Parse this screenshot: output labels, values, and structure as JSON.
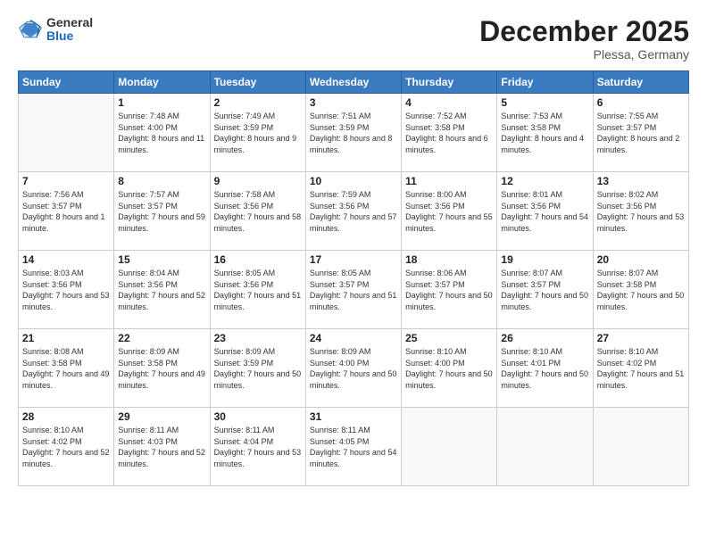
{
  "header": {
    "logo": {
      "general": "General",
      "blue": "Blue"
    },
    "title": "December 2025",
    "location": "Plessa, Germany"
  },
  "days_of_week": [
    "Sunday",
    "Monday",
    "Tuesday",
    "Wednesday",
    "Thursday",
    "Friday",
    "Saturday"
  ],
  "weeks": [
    [
      {
        "day": "",
        "empty": true
      },
      {
        "day": "1",
        "sunrise": "Sunrise: 7:48 AM",
        "sunset": "Sunset: 4:00 PM",
        "daylight": "Daylight: 8 hours and 11 minutes."
      },
      {
        "day": "2",
        "sunrise": "Sunrise: 7:49 AM",
        "sunset": "Sunset: 3:59 PM",
        "daylight": "Daylight: 8 hours and 9 minutes."
      },
      {
        "day": "3",
        "sunrise": "Sunrise: 7:51 AM",
        "sunset": "Sunset: 3:59 PM",
        "daylight": "Daylight: 8 hours and 8 minutes."
      },
      {
        "day": "4",
        "sunrise": "Sunrise: 7:52 AM",
        "sunset": "Sunset: 3:58 PM",
        "daylight": "Daylight: 8 hours and 6 minutes."
      },
      {
        "day": "5",
        "sunrise": "Sunrise: 7:53 AM",
        "sunset": "Sunset: 3:58 PM",
        "daylight": "Daylight: 8 hours and 4 minutes."
      },
      {
        "day": "6",
        "sunrise": "Sunrise: 7:55 AM",
        "sunset": "Sunset: 3:57 PM",
        "daylight": "Daylight: 8 hours and 2 minutes."
      }
    ],
    [
      {
        "day": "7",
        "sunrise": "Sunrise: 7:56 AM",
        "sunset": "Sunset: 3:57 PM",
        "daylight": "Daylight: 8 hours and 1 minute."
      },
      {
        "day": "8",
        "sunrise": "Sunrise: 7:57 AM",
        "sunset": "Sunset: 3:57 PM",
        "daylight": "Daylight: 7 hours and 59 minutes."
      },
      {
        "day": "9",
        "sunrise": "Sunrise: 7:58 AM",
        "sunset": "Sunset: 3:56 PM",
        "daylight": "Daylight: 7 hours and 58 minutes."
      },
      {
        "day": "10",
        "sunrise": "Sunrise: 7:59 AM",
        "sunset": "Sunset: 3:56 PM",
        "daylight": "Daylight: 7 hours and 57 minutes."
      },
      {
        "day": "11",
        "sunrise": "Sunrise: 8:00 AM",
        "sunset": "Sunset: 3:56 PM",
        "daylight": "Daylight: 7 hours and 55 minutes."
      },
      {
        "day": "12",
        "sunrise": "Sunrise: 8:01 AM",
        "sunset": "Sunset: 3:56 PM",
        "daylight": "Daylight: 7 hours and 54 minutes."
      },
      {
        "day": "13",
        "sunrise": "Sunrise: 8:02 AM",
        "sunset": "Sunset: 3:56 PM",
        "daylight": "Daylight: 7 hours and 53 minutes."
      }
    ],
    [
      {
        "day": "14",
        "sunrise": "Sunrise: 8:03 AM",
        "sunset": "Sunset: 3:56 PM",
        "daylight": "Daylight: 7 hours and 53 minutes."
      },
      {
        "day": "15",
        "sunrise": "Sunrise: 8:04 AM",
        "sunset": "Sunset: 3:56 PM",
        "daylight": "Daylight: 7 hours and 52 minutes."
      },
      {
        "day": "16",
        "sunrise": "Sunrise: 8:05 AM",
        "sunset": "Sunset: 3:56 PM",
        "daylight": "Daylight: 7 hours and 51 minutes."
      },
      {
        "day": "17",
        "sunrise": "Sunrise: 8:05 AM",
        "sunset": "Sunset: 3:57 PM",
        "daylight": "Daylight: 7 hours and 51 minutes."
      },
      {
        "day": "18",
        "sunrise": "Sunrise: 8:06 AM",
        "sunset": "Sunset: 3:57 PM",
        "daylight": "Daylight: 7 hours and 50 minutes."
      },
      {
        "day": "19",
        "sunrise": "Sunrise: 8:07 AM",
        "sunset": "Sunset: 3:57 PM",
        "daylight": "Daylight: 7 hours and 50 minutes."
      },
      {
        "day": "20",
        "sunrise": "Sunrise: 8:07 AM",
        "sunset": "Sunset: 3:58 PM",
        "daylight": "Daylight: 7 hours and 50 minutes."
      }
    ],
    [
      {
        "day": "21",
        "sunrise": "Sunrise: 8:08 AM",
        "sunset": "Sunset: 3:58 PM",
        "daylight": "Daylight: 7 hours and 49 minutes."
      },
      {
        "day": "22",
        "sunrise": "Sunrise: 8:09 AM",
        "sunset": "Sunset: 3:58 PM",
        "daylight": "Daylight: 7 hours and 49 minutes."
      },
      {
        "day": "23",
        "sunrise": "Sunrise: 8:09 AM",
        "sunset": "Sunset: 3:59 PM",
        "daylight": "Daylight: 7 hours and 50 minutes."
      },
      {
        "day": "24",
        "sunrise": "Sunrise: 8:09 AM",
        "sunset": "Sunset: 4:00 PM",
        "daylight": "Daylight: 7 hours and 50 minutes."
      },
      {
        "day": "25",
        "sunrise": "Sunrise: 8:10 AM",
        "sunset": "Sunset: 4:00 PM",
        "daylight": "Daylight: 7 hours and 50 minutes."
      },
      {
        "day": "26",
        "sunrise": "Sunrise: 8:10 AM",
        "sunset": "Sunset: 4:01 PM",
        "daylight": "Daylight: 7 hours and 50 minutes."
      },
      {
        "day": "27",
        "sunrise": "Sunrise: 8:10 AM",
        "sunset": "Sunset: 4:02 PM",
        "daylight": "Daylight: 7 hours and 51 minutes."
      }
    ],
    [
      {
        "day": "28",
        "sunrise": "Sunrise: 8:10 AM",
        "sunset": "Sunset: 4:02 PM",
        "daylight": "Daylight: 7 hours and 52 minutes."
      },
      {
        "day": "29",
        "sunrise": "Sunrise: 8:11 AM",
        "sunset": "Sunset: 4:03 PM",
        "daylight": "Daylight: 7 hours and 52 minutes."
      },
      {
        "day": "30",
        "sunrise": "Sunrise: 8:11 AM",
        "sunset": "Sunset: 4:04 PM",
        "daylight": "Daylight: 7 hours and 53 minutes."
      },
      {
        "day": "31",
        "sunrise": "Sunrise: 8:11 AM",
        "sunset": "Sunset: 4:05 PM",
        "daylight": "Daylight: 7 hours and 54 minutes."
      },
      {
        "day": "",
        "empty": true
      },
      {
        "day": "",
        "empty": true
      },
      {
        "day": "",
        "empty": true
      }
    ]
  ]
}
